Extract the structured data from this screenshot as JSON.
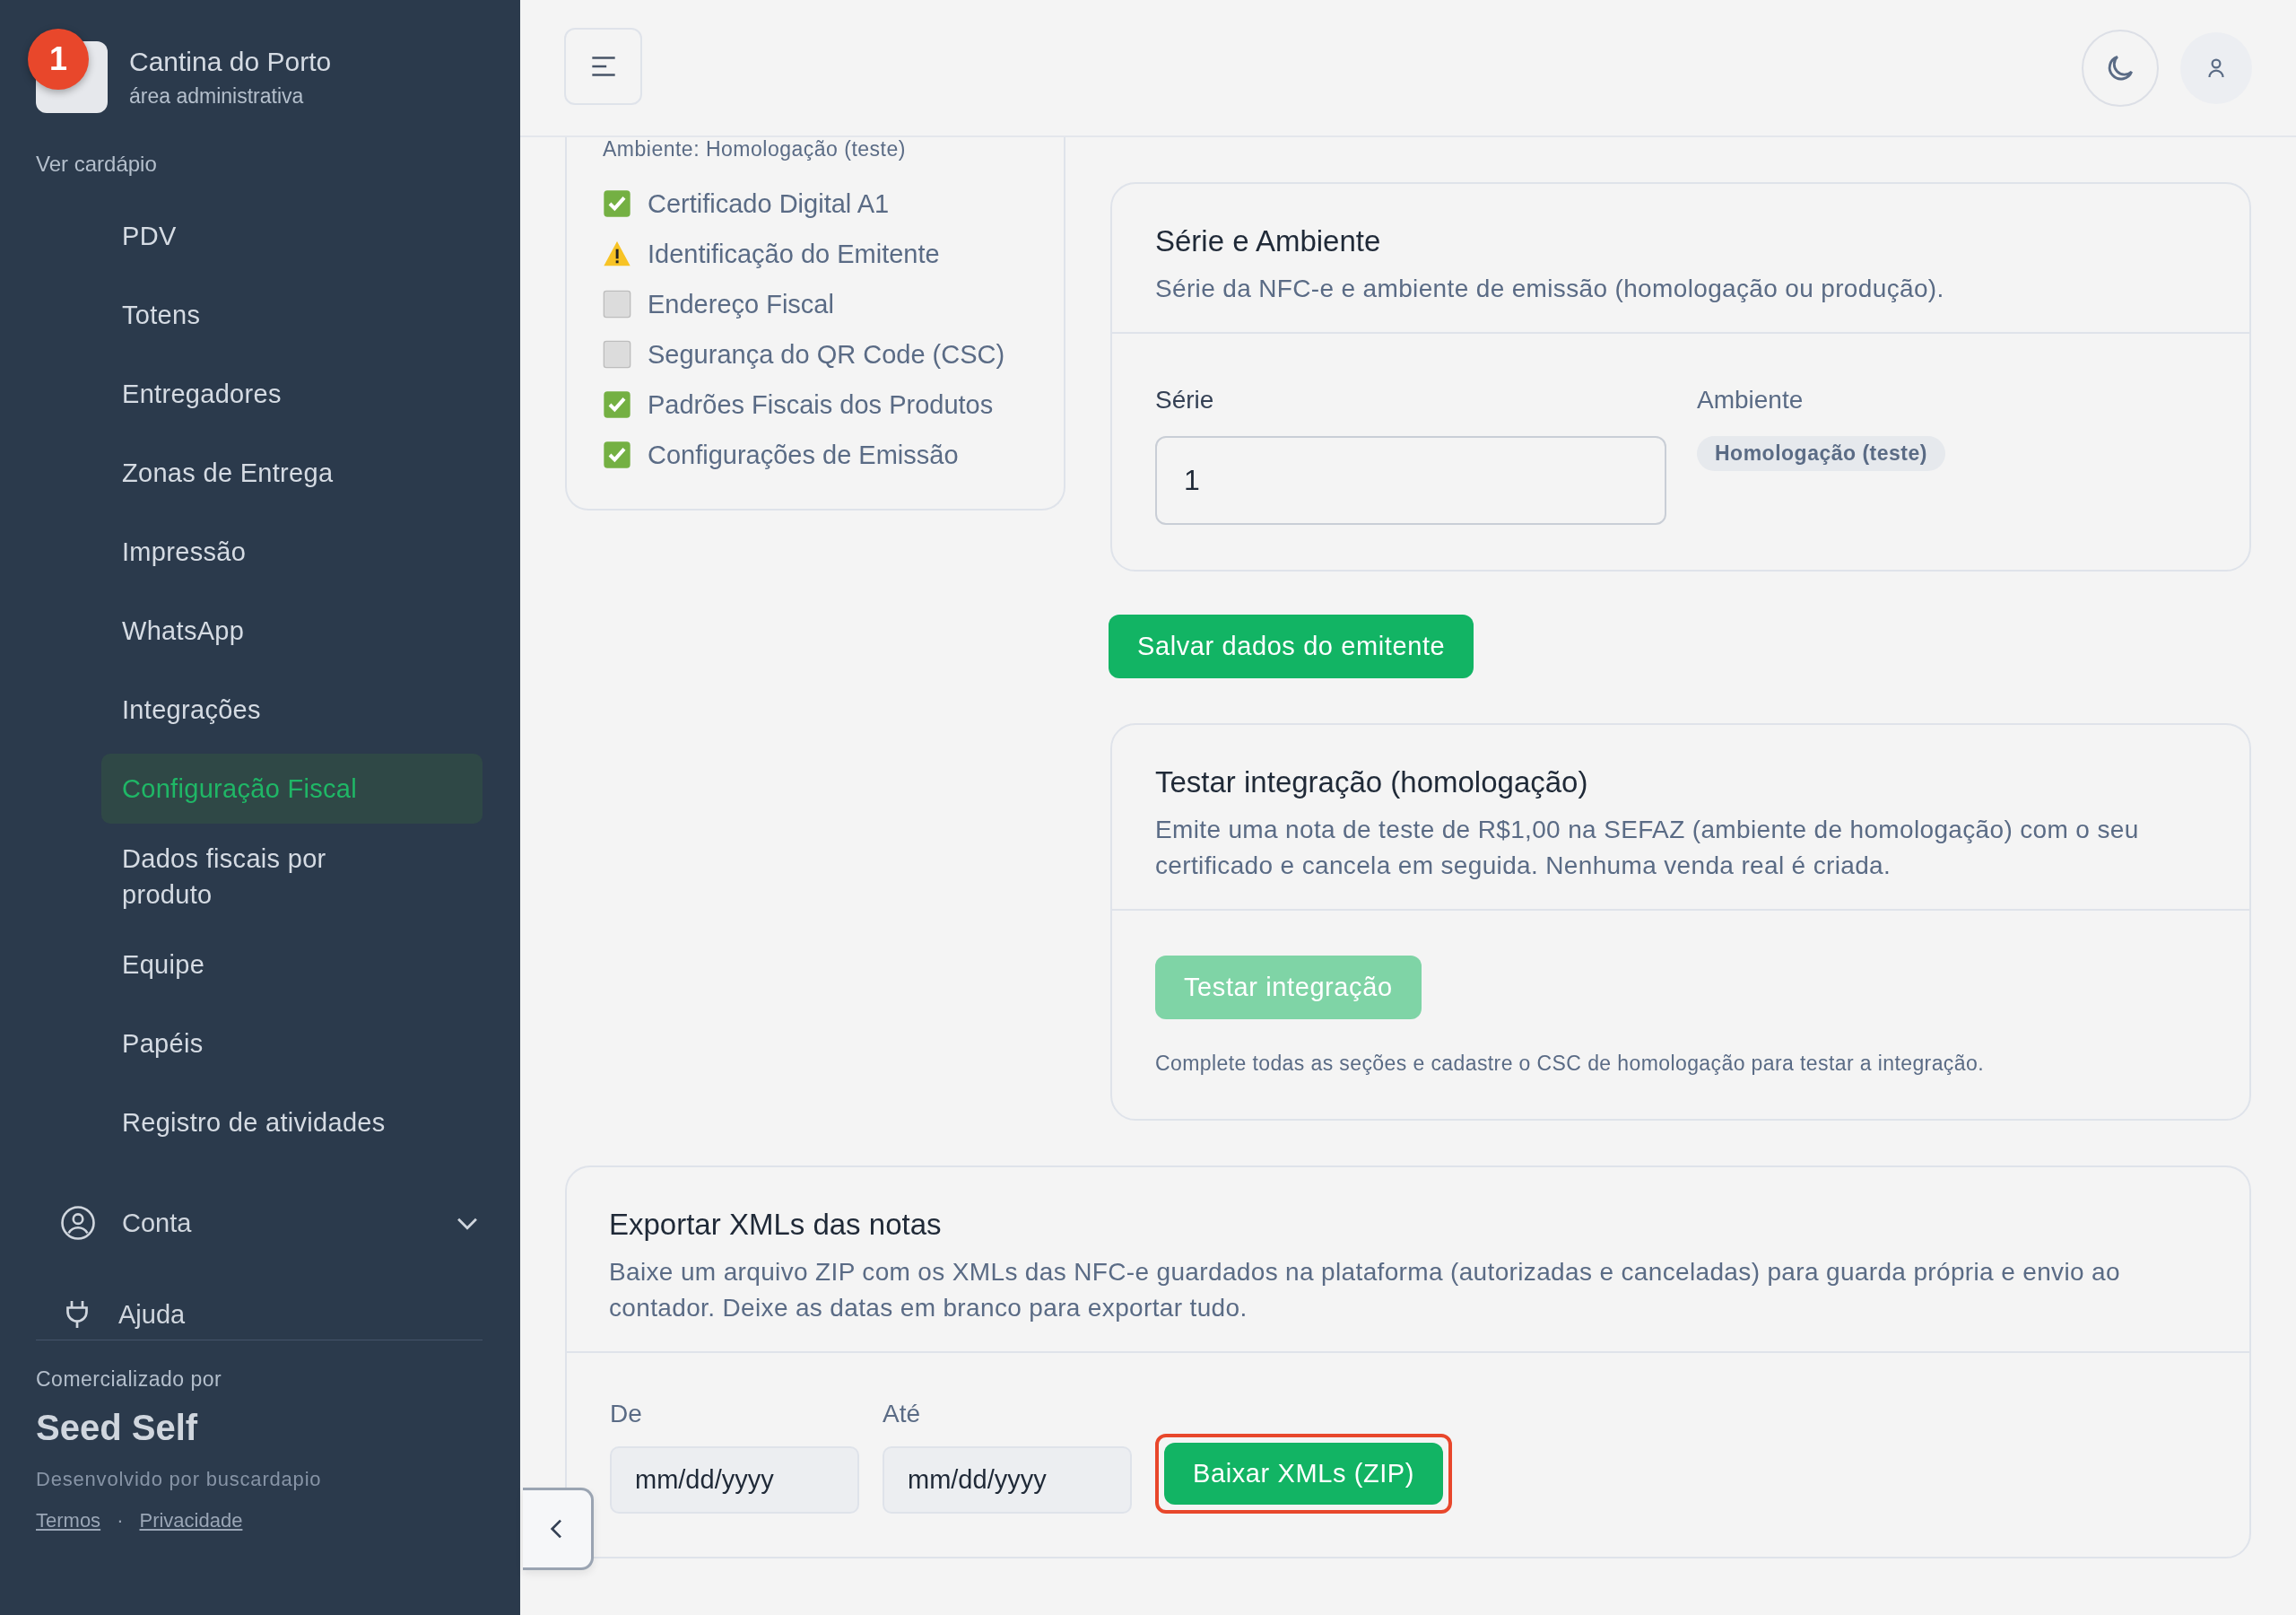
{
  "annotation_badge": "1",
  "sidebar": {
    "brand": "Cantina do Porto",
    "subtitle": "área administrativa",
    "menu_link": "Ver cardápio",
    "items": [
      {
        "label": "PDV",
        "selected": false
      },
      {
        "label": "Totens",
        "selected": false
      },
      {
        "label": "Entregadores",
        "selected": false
      },
      {
        "label": "Zonas de Entrega",
        "selected": false
      },
      {
        "label": "Impressão",
        "selected": false
      },
      {
        "label": "WhatsApp",
        "selected": false
      },
      {
        "label": "Integrações",
        "selected": false
      },
      {
        "label": "Configuração Fiscal",
        "selected": true
      },
      {
        "label": "Dados fiscais por produto",
        "selected": false
      },
      {
        "label": "Equipe",
        "selected": false
      },
      {
        "label": "Papéis",
        "selected": false
      },
      {
        "label": "Registro de atividades",
        "selected": false
      }
    ],
    "account": {
      "label": "Conta",
      "expanded": false
    },
    "help": "Ajuda",
    "marketed_by": "Comercializado por",
    "vendor": "Seed Self",
    "developed_by": "Desenvolvido por buscardapio",
    "links": [
      "Termos",
      "Privacidade"
    ],
    "link_separator": "·"
  },
  "checklist": {
    "environment": "Ambiente: Homologação (teste)",
    "items": [
      {
        "label": "Certificado Digital A1",
        "kind": "done"
      },
      {
        "label": "Identificação do Emitente",
        "kind": "warning"
      },
      {
        "label": "Endereço Fiscal",
        "kind": "pending"
      },
      {
        "label": "Segurança do QR Code (CSC)",
        "kind": "pending"
      },
      {
        "label": "Padrões Fiscais dos Produtos",
        "kind": "done"
      },
      {
        "label": "Configurações de Emissão",
        "kind": "done"
      }
    ]
  },
  "series_card": {
    "title": "Série e Ambiente",
    "description": "Série da NFC-e e ambiente de emissão (homologação ou produção).",
    "series_label": "Série",
    "series_value": "1",
    "environment_label": "Ambiente",
    "environment_badge": "Homologação (teste)"
  },
  "save_button": "Salvar dados do emitente",
  "test_card": {
    "title": "Testar integração (homologação)",
    "description": "Emite uma nota de teste de R$1,00 na SEFAZ (ambiente de homologação) com o seu certificado e cancela em seguida. Nenhuma venda real é criada.",
    "button": {
      "label": "Testar integração",
      "disabled": true
    },
    "note": "Complete todas as seções e cadastre o CSC de homologação para testar a integração."
  },
  "export_card": {
    "title": "Exportar XMLs das notas",
    "description": "Baixe um arquivo ZIP com os XMLs das NFC-e guardados na plataforma (autorizadas e canceladas) para guarda própria e envio ao contador. Deixe as datas em branco para exportar tudo.",
    "from_label": "De",
    "from_placeholder": "mm/dd/yyyy",
    "to_label": "Até",
    "to_placeholder": "mm/dd/yyyy",
    "button": {
      "label": "Baixar XMLs (ZIP)",
      "highlighted": true
    }
  }
}
